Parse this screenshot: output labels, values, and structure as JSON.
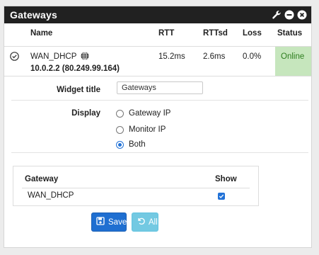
{
  "panel": {
    "title": "Gateways",
    "controls": [
      {
        "icon": "wrench-icon"
      },
      {
        "icon": "minus-circle-icon"
      },
      {
        "icon": "close-circle-icon"
      }
    ]
  },
  "table": {
    "headers": [
      "Name",
      "RTT",
      "RTTsd",
      "Loss",
      "Status"
    ],
    "rows": [
      {
        "name": "WAN_DHCP",
        "address": "10.0.2.2 (80.249.99.164)",
        "rtt": "15.2ms",
        "rttsd": "2.6ms",
        "loss": "0.0%",
        "status": "Online",
        "status_color": "#c6e6bd",
        "icon": "check-circle-icon",
        "name_icon": "globe-icon"
      }
    ]
  },
  "form": {
    "widget_title_label": "Widget title",
    "widget_title_value": "Gateways",
    "display_label": "Display",
    "display_options": [
      {
        "label": "Gateway IP",
        "checked": false
      },
      {
        "label": "Monitor IP",
        "checked": false
      },
      {
        "label": "Both",
        "checked": true
      }
    ]
  },
  "gateway_select": {
    "headers": [
      "Gateway",
      "Show"
    ],
    "rows": [
      {
        "gateway": "WAN_DHCP",
        "show": true
      }
    ]
  },
  "buttons": {
    "save": "Save",
    "all": "All"
  },
  "colors": {
    "header_bg": "#212121",
    "accent": "#2272d7",
    "online_bg": "#c6e6bd",
    "save_btn": "#1f6fd1",
    "all_btn": "#5bc0de"
  }
}
